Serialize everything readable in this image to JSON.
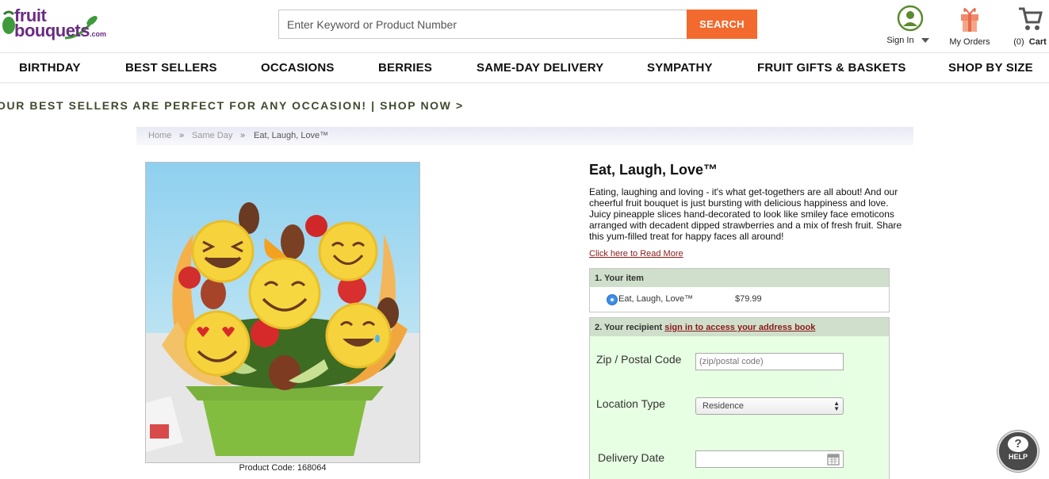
{
  "brand": {
    "line1": "fruit",
    "line2": "bouquets",
    "suffix": ".com",
    "tm": "TM"
  },
  "search": {
    "placeholder": "Enter Keyword or Product Number",
    "button": "SEARCH"
  },
  "header": {
    "signin": "Sign In",
    "orders": "My Orders",
    "cart_count": "(0)",
    "cart": "Cart"
  },
  "nav": [
    "BIRTHDAY",
    "BEST SELLERS",
    "OCCASIONS",
    "BERRIES",
    "SAME-DAY DELIVERY",
    "SYMPATHY",
    "FRUIT GIFTS & BASKETS",
    "SHOP BY SIZE"
  ],
  "promo": "OUR BEST SELLERS ARE PERFECT FOR ANY OCCASION! | SHOP NOW >",
  "breadcrumb": {
    "home": "Home",
    "sep": "»",
    "category": "Same Day",
    "current": "Eat, Laugh, Love™"
  },
  "product": {
    "title": "Eat, Laugh, Love™",
    "description": "Eating, laughing and loving - it's what get-togethers are all about! And our cheerful fruit bouquet is just bursting with delicious happiness and love. Juicy pineapple slices hand-decorated to look like smiley face emoticons arranged with decadent dipped strawberries and a mix of fresh fruit. Share this yum-filled treat for happy faces all around!",
    "read_more": "Click here to Read More",
    "code": "Product Code: 168064"
  },
  "order": {
    "step1": "1. Your item",
    "item_name": "Eat, Laugh, Love™",
    "item_price": "$79.99",
    "step2": "2. Your recipient",
    "step2_link": "sign in to access your address book",
    "zip_label": "Zip / Postal Code",
    "zip_placeholder": "(zip/postal code)",
    "location_label": "Location Type",
    "location_value": "Residence",
    "date_label": "Delivery Date"
  },
  "help": "HELP",
  "colors": {
    "accent": "#f26a2e",
    "brand": "#6b2c82",
    "section_green": "#cfdfcb",
    "form_bg": "#e7ffe3"
  }
}
